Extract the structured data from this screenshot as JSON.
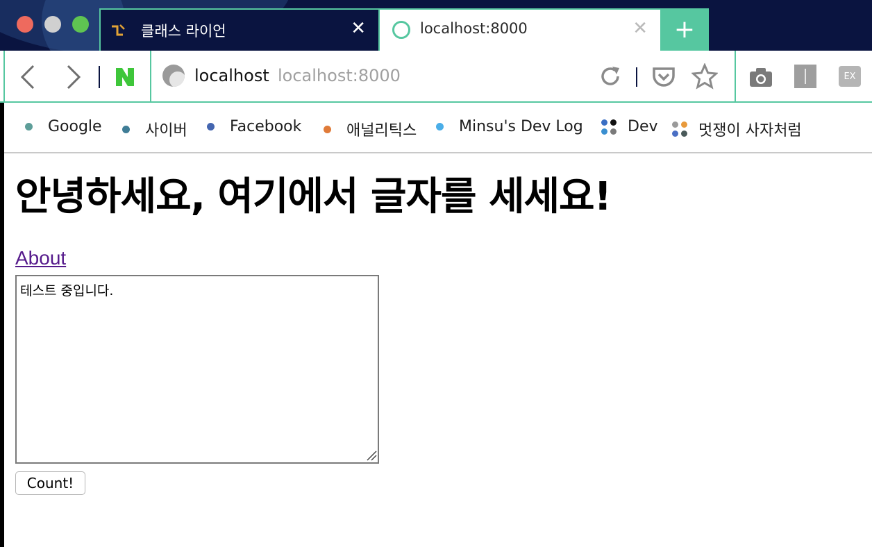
{
  "window": {
    "tabs": [
      {
        "label": "클래스 라이언",
        "close": "✕"
      },
      {
        "label": "localhost:8000",
        "close": "✕"
      }
    ],
    "new_tab": "+"
  },
  "toolbar": {
    "url_host": "localhost",
    "url_full": "localhost:8000",
    "ext_label": "EX",
    "icons": [
      "back-icon",
      "forward-icon",
      "naver-icon",
      "site-icon",
      "reload-icon",
      "pocket-icon",
      "star-icon",
      "camera-icon",
      "reader-icon",
      "extension-icon"
    ]
  },
  "bookmarks": [
    {
      "label": "Google",
      "color": "#5e9e99"
    },
    {
      "label": "사이버",
      "color": "#3f7d96"
    },
    {
      "label": "Facebook",
      "color": "#4566b0"
    },
    {
      "label": "애널리틱스",
      "color": "#e07b39"
    },
    {
      "label": "Minsu's Dev Log",
      "color": "#4aaee8"
    },
    {
      "label": "Dev"
    },
    {
      "label": "멋쟁이 사자처럼"
    }
  ],
  "page": {
    "title": "안녕하세요, 여기에서 글자를 세세요!",
    "about_link": "About",
    "textarea_value": "테스트 중입니다.",
    "button_label": "Count!"
  },
  "colors": {
    "accent": "#56c7a0",
    "titlebar": "#0a1440",
    "link": "#551a8b"
  }
}
